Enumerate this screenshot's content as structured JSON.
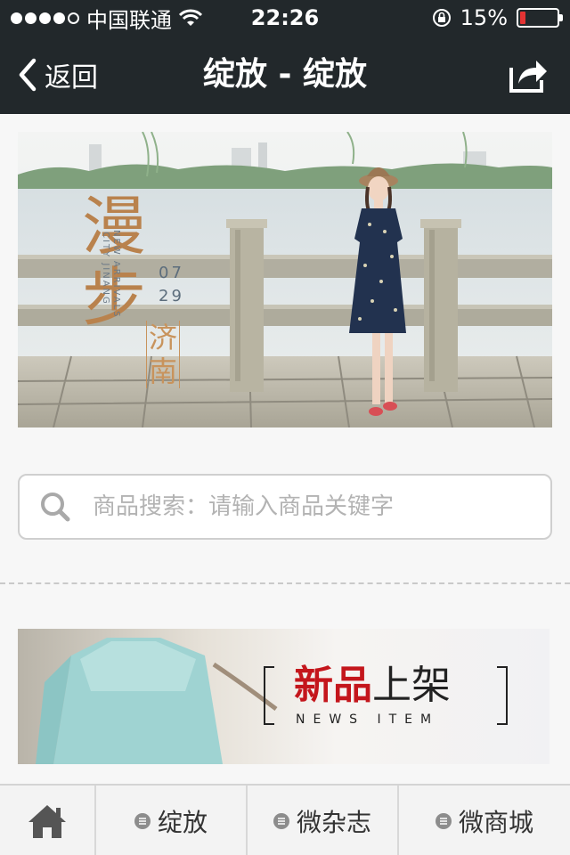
{
  "status_bar": {
    "carrier": "中国联通",
    "time": "22:26",
    "battery": "15%",
    "battery_level": 0.15,
    "signal_bars": 4,
    "signal_max": 5
  },
  "nav": {
    "back_label": "返回",
    "title": "绽放 - 绽放",
    "share_icon": "share-icon"
  },
  "banner": {
    "headline": "漫步",
    "date_month": "07",
    "date_day": "29",
    "subtitle_line1": "NEW ARRIVALS",
    "subtitle_line2": "CITY JINANG",
    "city": "济南"
  },
  "search": {
    "placeholder": "商品搜索：请输入商品关键字",
    "value": ""
  },
  "promo": {
    "title_red": "新品",
    "title_black": "上架",
    "subtitle": "NEWS ITEM"
  },
  "tabs": [
    {
      "label": "绽放",
      "icon": "menu-icon"
    },
    {
      "label": "微杂志",
      "icon": "menu-icon"
    },
    {
      "label": "微商城",
      "icon": "menu-icon"
    }
  ],
  "colors": {
    "bar_bg": "#22282b",
    "battery_low": "#e33333",
    "promo_red": "#c4161c"
  }
}
